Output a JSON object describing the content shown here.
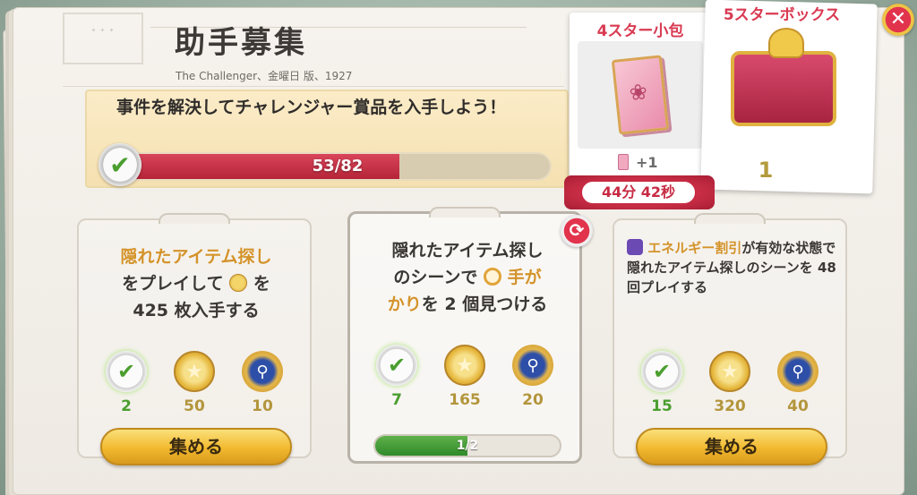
{
  "header": {
    "title": "助手募集",
    "subtitle": "The Challenger、金曜日 版、1927"
  },
  "banner": {
    "text": "事件を解決してチャレンジャー賞品を入手しよう！",
    "progress": {
      "current": 53,
      "total": 82,
      "label": "53/82"
    }
  },
  "rewards_panel": {
    "small_pack": {
      "title": "4スター小包",
      "count": "+1",
      "timer": "44分 42秒"
    },
    "big_box": {
      "title": "5スターボックス",
      "count": "1"
    }
  },
  "missions": [
    {
      "text_before": "隠れたアイテム探し",
      "text_mid": "をプレイして",
      "text_after": "を",
      "text_end": "425 枚入手する",
      "rewards": {
        "check": "2",
        "coins": "50",
        "magnifier": "10"
      },
      "button": "集める"
    },
    {
      "text_a": "隠れたアイテム探し",
      "text_b": "のシーンで",
      "text_hl1": "手が",
      "text_hl2": "かり",
      "text_c": "を 2 個見つける",
      "rewards": {
        "check": "7",
        "coins": "165",
        "magnifier": "20"
      },
      "progress": {
        "current": 1,
        "total": 2,
        "label": "1/2"
      }
    },
    {
      "text_hl": "エネルギー割引",
      "text_rest": "が有効な状態で隠れたアイテム探しのシーンを 48 回プレイする",
      "rewards": {
        "check": "15",
        "coins": "320",
        "magnifier": "40"
      },
      "button": "集める"
    }
  ],
  "icons": {
    "close": "close-icon",
    "refresh": "refresh-icon",
    "check": "checkmark-badge-icon",
    "coin": "star-coin-icon",
    "magnifier": "magnifier-medal-icon"
  },
  "colors": {
    "accent_red": "#d93a52",
    "gold": "#d4932a",
    "progress_green": "#2f8a2a"
  }
}
